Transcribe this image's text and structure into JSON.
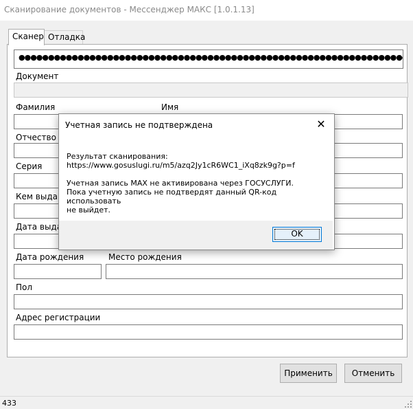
{
  "window": {
    "title": "Сканирование документов - Мессенджер МАКС [1.0.1.13]"
  },
  "tabs": [
    {
      "label": "Сканер"
    },
    {
      "label": "Отладка"
    }
  ],
  "scanner": {
    "scan_value": "●●●●●●●●●●●●●●●●●●●●●●●●●●●●●●●●●●●●●●●●●●●●●●●●●●●●●●●●●●●●●●●●●●",
    "fields": {
      "document": "Документ",
      "last_name": "Фамилия",
      "first_name": "Имя",
      "patronymic": "Отчество",
      "series": "Серия",
      "issued_by": "Кем выдан",
      "issue_date": "Дата выдачи",
      "birth_date": "Дата рождения",
      "birth_place": "Место рождения",
      "gender": "Пол",
      "address": "Адрес регистрации"
    }
  },
  "buttons": {
    "apply": "Применить",
    "cancel": "Отменить"
  },
  "status": {
    "count": "433"
  },
  "dialog": {
    "title": "Учетная запись не подтверждена",
    "close_glyph": "✕",
    "line1": "Результат сканирования:",
    "line2": "https://www.gosuslugi.ru/m5/azq2Jy1cR6WC1_iXq8zk9g?p=f",
    "line3": "Учетная запись MAX не активирована через ГОСУСЛУГИ.",
    "line4": "Пока учетную запись не подтвердят данный QR-код использовать",
    "line5": "не выйдет.",
    "ok": "OK"
  },
  "icons": {
    "close": "close-icon",
    "resize": "resize-grip-icon"
  },
  "colors": {
    "focus_border": "#0078d7",
    "button_face": "#e1e1e1"
  }
}
